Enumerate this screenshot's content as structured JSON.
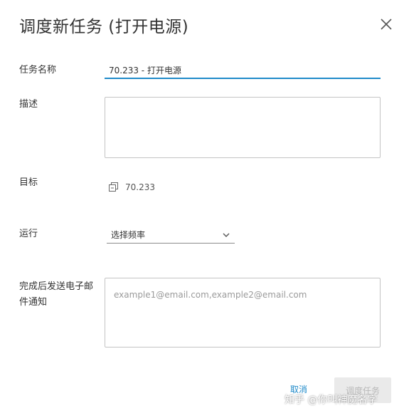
{
  "dialog": {
    "title": "调度新任务 (打开电源)"
  },
  "form": {
    "task_name_label": "任务名称",
    "task_name_value": "70.233 - 打开电源",
    "description_label": "描述",
    "description_value": "",
    "target_label": "目标",
    "target_value": "70.233",
    "target_icon": "vm-icon",
    "run_label": "运行",
    "run_select_value": "选择频率",
    "email_label": "完成后发送电子邮件通知",
    "email_placeholder": "example1@email.com,example2@email.com"
  },
  "footer": {
    "cancel_label": "取消",
    "submit_label": "调度任务"
  },
  "watermark": {
    "text": "知乎 @你叫神魔名字"
  },
  "colors": {
    "accent": "#1f8ac9",
    "disabled_button_bg": "#eaeaea",
    "disabled_button_text": "#b8b8b8"
  }
}
